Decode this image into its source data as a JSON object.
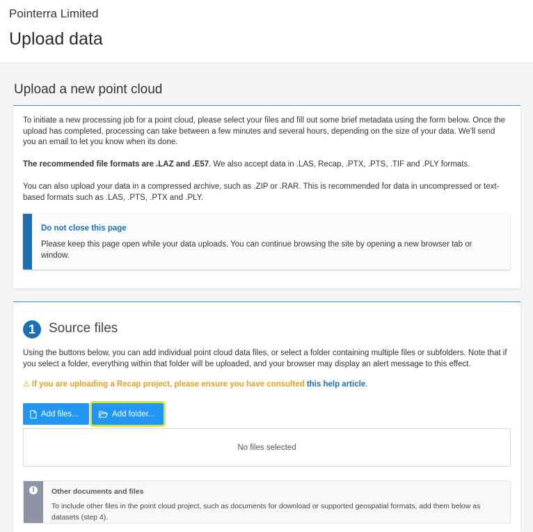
{
  "header": {
    "company": "Pointerra Limited",
    "title": "Upload data"
  },
  "section": {
    "title": "Upload a new point cloud"
  },
  "intro": {
    "p1": "To initiate a new processing job for a point cloud, please select your files and fill out some brief metadata using the form below. Once the upload has completed, processing can take between a few minutes and several hours, depending on the size of your data. We'll send you an email to let you know when its done.",
    "p2_bold": "The recommended file formats are .LAZ and .E57",
    "p2_rest": ". We also accept data in .LAS, Recap, .PTX, .PTS, .TIF and .PLY formats.",
    "p3": "You can also upload your data in a compressed archive, such as .ZIP or .RAR. This is recommended for data in uncompressed or text-based formats such as .LAS, .PTS, .PTX and .PLY."
  },
  "callout": {
    "title": "Do not close this page",
    "body": "Please keep this page open while your data uploads. You can continue browsing the site by opening a new browser tab or window.",
    "accent": "#1b6fb5"
  },
  "source": {
    "step": "1",
    "title": "Source files",
    "description": "Using the buttons below, you can add individual point cloud data files, or select a folder containing multiple files or subfolders. Note that if you select a folder, everything within that folder will be uploaded, and your browser may display an alert message to this effect.",
    "warning_text": "If you are uploading a Recap project, please ensure you have consulted",
    "warning_link": "this help article",
    "warning_end": ".",
    "warning_icon": "warning-triangle-icon",
    "add_files_label": "Add files...",
    "add_folder_label": "Add folder...",
    "empty_state": "No files selected"
  },
  "info": {
    "title": "Other documents and files",
    "body": "To include other files in the point cloud project, such as documents for download or supported geospatial formats, add them below as datasets (step 4)."
  },
  "colors": {
    "button": "#2196f3",
    "highlight": "#d6e62e",
    "warning": "#e4a021",
    "link": "#1b6fb5"
  }
}
